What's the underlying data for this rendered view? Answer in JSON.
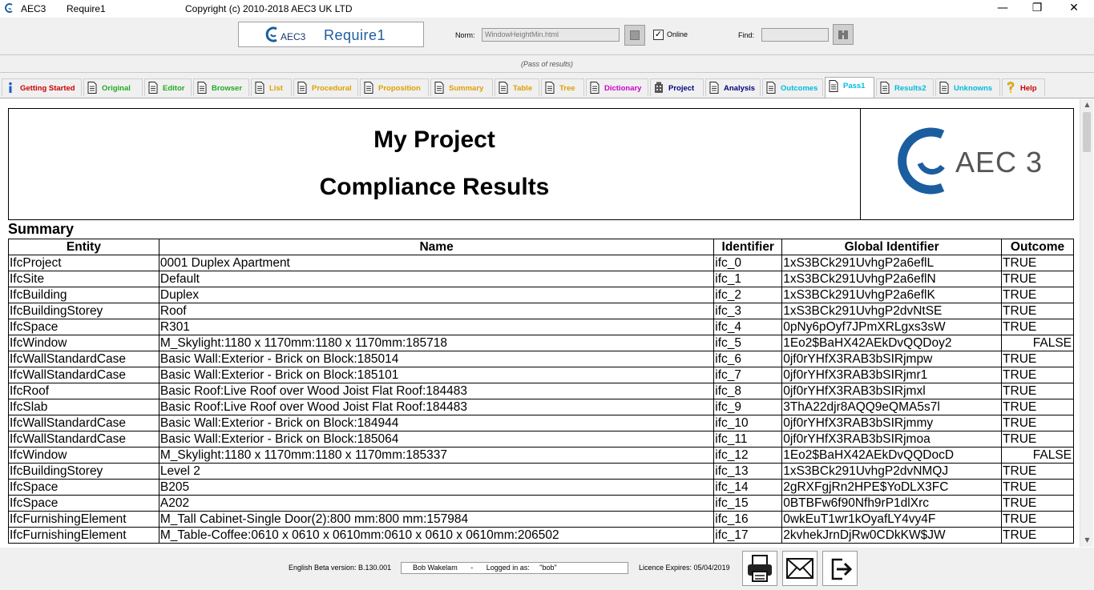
{
  "window": {
    "app_name": "AEC3",
    "module": "Require1",
    "copyright": "Copyright (c) 2010-2018  AEC3 UK LTD"
  },
  "toolbar": {
    "logo_aec": "AEC3",
    "logo_product": "Require1",
    "norm_label": "Norm:",
    "norm_value": "WindowHeightMin.html",
    "online_label": "Online",
    "online_checked": true,
    "find_label": "Find:",
    "find_value": ""
  },
  "status": {
    "text": "(Pass of results)"
  },
  "tabs": [
    {
      "label": "Getting Started",
      "color": "#cc0000",
      "icon": "info-icon"
    },
    {
      "label": "Original",
      "color": "#22aa22",
      "icon": "document-icon"
    },
    {
      "label": "Editor",
      "color": "#22aa22",
      "icon": "document-icon"
    },
    {
      "label": "Browser",
      "color": "#22aa22",
      "icon": "document-icon"
    },
    {
      "label": "List",
      "color": "#e0a000",
      "icon": "document-icon"
    },
    {
      "label": "Procedural",
      "color": "#e0a000",
      "icon": "document-icon"
    },
    {
      "label": "Proposition",
      "color": "#e0a000",
      "icon": "document-icon"
    },
    {
      "label": "Summary",
      "color": "#e0a000",
      "icon": "document-icon"
    },
    {
      "label": "Table",
      "color": "#e0a000",
      "icon": "document-icon"
    },
    {
      "label": "Tree",
      "color": "#e0a000",
      "icon": "document-icon"
    },
    {
      "label": "Dictionary",
      "color": "#cc00cc",
      "icon": "document-icon"
    },
    {
      "label": "Project",
      "color": "#000080",
      "icon": "building-icon"
    },
    {
      "label": "Analysis",
      "color": "#000080",
      "icon": "document-icon"
    },
    {
      "label": "Outcomes",
      "color": "#00bbdd",
      "icon": "document-icon"
    },
    {
      "label": "Pass1",
      "color": "#00bbdd",
      "icon": "document-icon"
    },
    {
      "label": "Results2",
      "color": "#00bbdd",
      "icon": "document-icon"
    },
    {
      "label": "Unknowns",
      "color": "#00bbdd",
      "icon": "document-icon"
    },
    {
      "label": "Help",
      "color": "#cc0000",
      "icon": "help-icon"
    }
  ],
  "active_tab": "Pass1",
  "report": {
    "project_title": "My Project",
    "report_title": "Compliance Results",
    "logo_text": "AEC 3",
    "summary_heading": "Summary",
    "columns": [
      "Entity",
      "Name",
      "Identifier",
      "Global Identifier",
      "Outcome"
    ],
    "rows": [
      [
        "IfcProject",
        "0001 Duplex Apartment",
        "ifc_0",
        "1xS3BCk291UvhgP2a6eflL",
        "TRUE"
      ],
      [
        "IfcSite",
        "Default",
        "ifc_1",
        "1xS3BCk291UvhgP2a6eflN",
        "TRUE"
      ],
      [
        "IfcBuilding",
        "Duplex",
        "ifc_2",
        "1xS3BCk291UvhgP2a6eflK",
        "TRUE"
      ],
      [
        "IfcBuildingStorey",
        "Roof",
        "ifc_3",
        "1xS3BCk291UvhgP2dvNtSE",
        "TRUE"
      ],
      [
        "IfcSpace",
        "R301",
        "ifc_4",
        "0pNy6pOyf7JPmXRLgxs3sW",
        "TRUE"
      ],
      [
        "IfcWindow",
        "M_Skylight:1180 x 1170mm:1180 x 1170mm:185718",
        "ifc_5",
        "1Eo2$BaHX42AEkDvQQDoy2",
        "FALSE"
      ],
      [
        "IfcWallStandardCase",
        "Basic Wall:Exterior - Brick on Block:185014",
        "ifc_6",
        "0jf0rYHfX3RAB3bSIRjmpw",
        "TRUE"
      ],
      [
        "IfcWallStandardCase",
        "Basic Wall:Exterior - Brick on Block:185101",
        "ifc_7",
        "0jf0rYHfX3RAB3bSIRjmr1",
        "TRUE"
      ],
      [
        "IfcRoof",
        "Basic Roof:Live Roof over Wood Joist Flat Roof:184483",
        "ifc_8",
        "0jf0rYHfX3RAB3bSIRjmxl",
        "TRUE"
      ],
      [
        "IfcSlab",
        "Basic Roof:Live Roof over Wood Joist Flat Roof:184483",
        "ifc_9",
        "3ThA22djr8AQQ9eQMA5s7l",
        "TRUE"
      ],
      [
        "IfcWallStandardCase",
        "Basic Wall:Exterior - Brick on Block:184944",
        "ifc_10",
        "0jf0rYHfX3RAB3bSIRjmmy",
        "TRUE"
      ],
      [
        "IfcWallStandardCase",
        "Basic Wall:Exterior - Brick on Block:185064",
        "ifc_11",
        "0jf0rYHfX3RAB3bSIRjmoa",
        "TRUE"
      ],
      [
        "IfcWindow",
        "M_Skylight:1180 x 1170mm:1180 x 1170mm:185337",
        "ifc_12",
        "1Eo2$BaHX42AEkDvQQDocD",
        "FALSE"
      ],
      [
        "IfcBuildingStorey",
        "Level 2",
        "ifc_13",
        "1xS3BCk291UvhgP2dvNMQJ",
        "TRUE"
      ],
      [
        "IfcSpace",
        "B205",
        "ifc_14",
        "2gRXFgjRn2HPE$YoDLX3FC",
        "TRUE"
      ],
      [
        "IfcSpace",
        "A202",
        "ifc_15",
        "0BTBFw6f90Nfh9rP1dlXrc",
        "TRUE"
      ],
      [
        "IfcFurnishingElement",
        "M_Tall Cabinet-Single Door(2):800 mm:800 mm:157984",
        "ifc_16",
        "0wkEuT1wr1kOyafLY4vy4F",
        "TRUE"
      ],
      [
        "IfcFurnishingElement",
        "M_Table-Coffee:0610 x 0610 x 0610mm:0610 x 0610 x 0610mm:206502",
        "ifc_17",
        "2kvhekJrnDjRw0CDkKW$JW",
        "TRUE"
      ]
    ]
  },
  "footer": {
    "version": "English Beta version: B.130.001",
    "user_name": "Bob Wakelam",
    "separator": "-",
    "logged_in_label": "Logged in as:",
    "login": "\"bob\"",
    "licence": "Licence Expires: 05/04/2019"
  },
  "colors": {
    "brand_blue": "#1a5ea0",
    "tab_active_bg": "#ffffff"
  }
}
